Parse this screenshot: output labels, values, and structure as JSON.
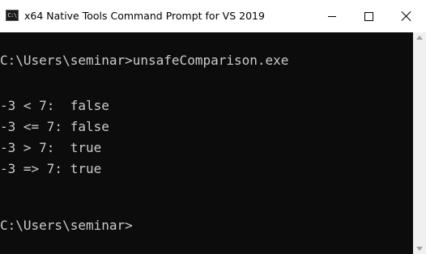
{
  "window": {
    "title": "x64 Native Tools Command Prompt for VS 2019",
    "icon_text": "C:\\",
    "icon": "console-app-icon",
    "colors": {
      "console_bg": "#0c0c0c",
      "console_text": "#cccccc",
      "titlebar_bg": "#ffffff"
    }
  },
  "title_controls": {
    "minimize": "minimize-icon",
    "maximize": "maximize-icon",
    "close": "close-icon"
  },
  "console": {
    "lines": [
      "C:\\Users\\seminar>unsafeComparison.exe",
      "-3 < 7:  false",
      "-3 <= 7: false",
      "-3 > 7:  true",
      "-3 => 7: true",
      "C:\\Users\\seminar>"
    ]
  },
  "scrollbar": {
    "up": "scroll-up-arrow-icon",
    "down": "scroll-down-arrow-icon"
  }
}
